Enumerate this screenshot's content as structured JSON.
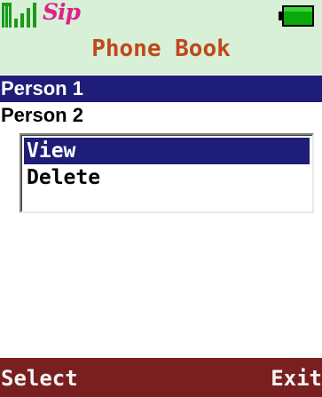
{
  "status_bar": {
    "signal_icon": "signal-strength-icon",
    "sip_label": "Sip",
    "battery_icon": "battery-icon"
  },
  "title": "Phone Book",
  "contacts": [
    {
      "name": "Person 1",
      "selected": true
    },
    {
      "name": "Person 2",
      "selected": false
    }
  ],
  "options_menu": {
    "items": [
      {
        "label": "View",
        "selected": true
      },
      {
        "label": "Delete",
        "selected": false
      }
    ]
  },
  "softkeys": {
    "left": "Select",
    "right": "Exit"
  },
  "colors": {
    "header_bg": "#d7f0d7",
    "title": "#c2471a",
    "selection": "#1e1e78",
    "softkey_bar": "#7a1f1f",
    "battery": "#00a000",
    "signal": "#00a000",
    "sip": "#e0208a"
  }
}
